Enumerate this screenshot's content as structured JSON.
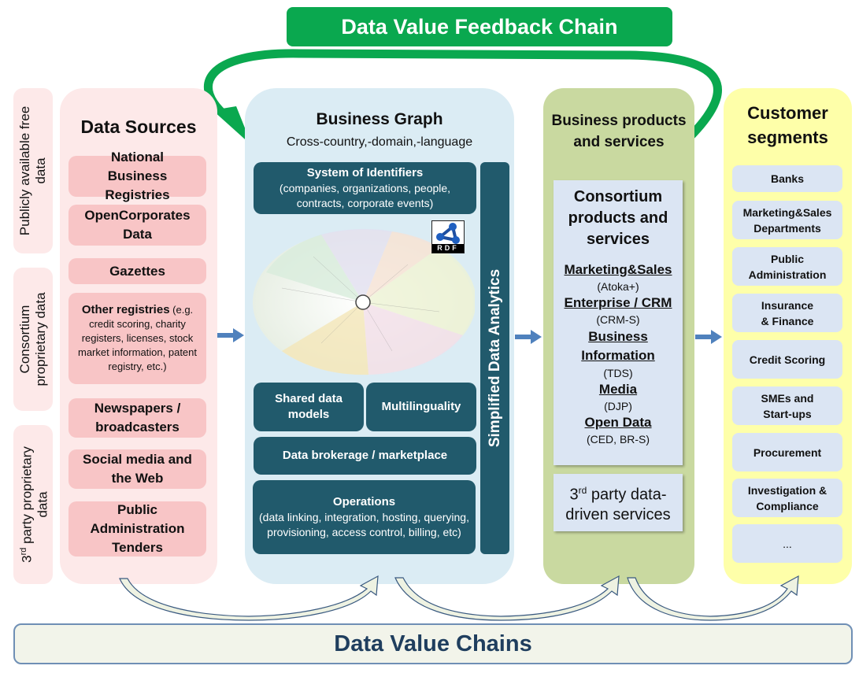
{
  "header": {
    "feedback_chain_title": "Data Value Feedback Chain"
  },
  "categories": [
    {
      "label_line1": "Publicly available free",
      "label_line2": "data"
    },
    {
      "label_line1": "Consortium",
      "label_line2": "proprietary data"
    },
    {
      "label_line1": "3rd party proprietary",
      "label_line2": "data"
    }
  ],
  "data_sources": {
    "title": "Data Sources",
    "items": [
      {
        "label": "National Business Registries"
      },
      {
        "label": "OpenCorporates Data"
      },
      {
        "label": "Gazettes"
      },
      {
        "label_bold": "Other registries",
        "label_rest": " (e.g. credit scoring, charity registers, licenses, stock market information, patent registry, etc.)"
      },
      {
        "label": "Newspapers / broadcasters"
      },
      {
        "label": "Social media and the Web"
      },
      {
        "label": "Public Administration Tenders"
      }
    ]
  },
  "business_graph": {
    "title": "Business Graph",
    "subtitle": "Cross-country,-domain,-language",
    "identifiers_title": "System of Identifiers",
    "identifiers_detail": "(companies, organizations, people, contracts, corporate events)",
    "rdf_label": "RDF",
    "shared_models": "Shared data models",
    "multilinguality": "Multilinguality",
    "brokerage": "Data brokerage / marketplace",
    "operations_title": "Operations",
    "operations_detail": "(data linking, integration, hosting, querying, provisioning, access control, billing, etc)",
    "analytics": "Simplified Data Analytics"
  },
  "business_products": {
    "title": "Business products and services",
    "consortium_title": "Consortium products and services",
    "products": [
      {
        "name": "Marketing&Sales",
        "code": "(Atoka+)"
      },
      {
        "name": "Enterprise / CRM",
        "code": "(CRM-S)"
      },
      {
        "name": "Business Information",
        "code": "(TDS)"
      },
      {
        "name": "Media",
        "code": "(DJP)"
      },
      {
        "name": "Open Data",
        "code": "(CED, BR-S)"
      }
    ],
    "third_party_prefix": "3",
    "third_party_sup": "rd",
    "third_party_rest": " party data-driven services"
  },
  "customer_segments": {
    "title": "Customer segments",
    "items": [
      "Banks",
      "Marketing&Sales Departments",
      "Public Administration",
      "Insurance & Finance",
      "Credit Scoring",
      "SMEs and Start-ups",
      "Procurement",
      "Investigation & Compliance",
      "..."
    ]
  },
  "footer": {
    "value_chains_title": "Data Value Chains"
  },
  "colors": {
    "feedback_green": "#0aa84f",
    "data_sources_bg": "#fde9e9",
    "data_source_box": "#f8c5c6",
    "business_graph_bg": "#dbecf4",
    "teal_box": "#215a6c",
    "business_products_bg": "#c9d9a0",
    "customer_segments_bg": "#feffa9",
    "item_box_blue": "#dbe5f3",
    "flow_arrow_blue": "#4f81bd",
    "value_chain_text": "#1f3e5e"
  }
}
